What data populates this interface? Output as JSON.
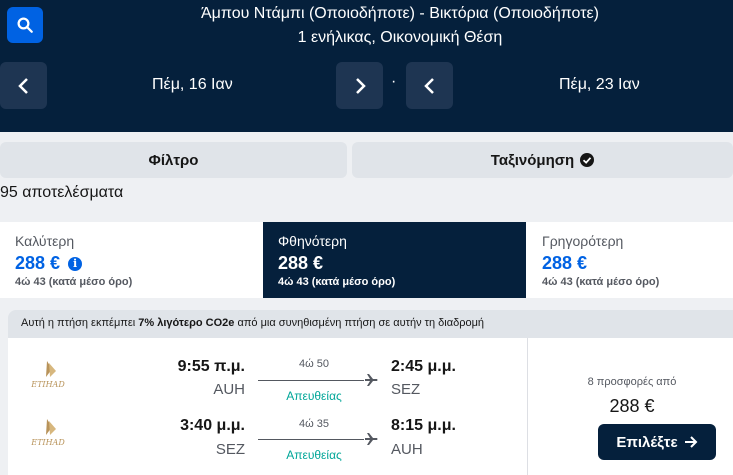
{
  "header": {
    "route": "Άμπου Ντάμπι (Οποιοδήποτε) - Βικτόρια (Οποιοδήποτε)",
    "travellers": "1 ενήλικας, Οικονομική Θέση",
    "search_icon": "search-icon"
  },
  "dates": {
    "outbound": "Πέμ, 16 Ιαν",
    "separator": "·",
    "return": "Πέμ, 23 Ιαν"
  },
  "toolbar": {
    "filter_label": "Φίλτρο",
    "sort_label": "Ταξινόμηση"
  },
  "results_count": "95 αποτελέσματα",
  "sort_tabs": [
    {
      "title": "Καλύτερη",
      "price": "288 €",
      "duration": "4ώ 43 (κατά μέσο όρο)"
    },
    {
      "title": "Φθηνότερη",
      "price": "288 €",
      "duration": "4ώ 43 (κατά μέσο όρο)"
    },
    {
      "title": "Γρηγορότερη",
      "price": "288 €",
      "duration": "4ώ 43 (κατά μέσο όρο)"
    }
  ],
  "eco_banner": {
    "prefix": "Αυτή η πτήση εκπέμπει ",
    "highlight": "7% λιγότερο CO2e",
    "suffix": " από μια συνηθισμένη πτήση σε αυτήν τη διαδρομή"
  },
  "itinerary": {
    "airline_logo_text": "ETIHAD",
    "legs": [
      {
        "depart_time": "9:55 π.μ.",
        "depart_code": "AUH",
        "duration": "4ώ 50",
        "stops": "Απευθείας",
        "arrive_time": "2:45 μ.μ.",
        "arrive_code": "SEZ"
      },
      {
        "depart_time": "3:40 μ.μ.",
        "depart_code": "SEZ",
        "duration": "4ώ 35",
        "stops": "Απευθείας",
        "arrive_time": "8:15 μ.μ.",
        "arrive_code": "AUH"
      }
    ],
    "offers": "8 προσφορές από",
    "price": "288 €",
    "select_label": "Επιλέξτε"
  },
  "colors": {
    "header_bg": "#05203c",
    "accent": "#0062e3",
    "direct": "#00a698"
  }
}
